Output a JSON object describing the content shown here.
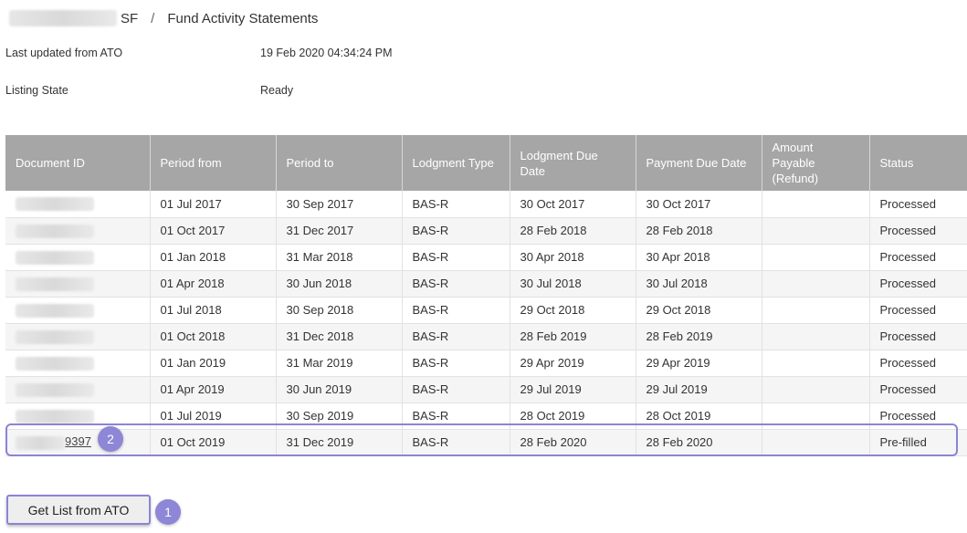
{
  "breadcrumb": {
    "fund_suffix": "SF",
    "separator": "/",
    "page": "Fund Activity Statements"
  },
  "info": {
    "last_updated_label": "Last updated from ATO",
    "last_updated_value": "19 Feb 2020 04:34:24 PM",
    "listing_state_label": "Listing State",
    "listing_state_value": "Ready"
  },
  "table": {
    "headers": {
      "document_id": "Document ID",
      "period_from": "Period from",
      "period_to": "Period to",
      "lodgment_type": "Lodgment Type",
      "lodgment_due_date": "Lodgment Due Date",
      "payment_due_date": "Payment Due Date",
      "amount_payable": "Amount Payable (Refund)",
      "status": "Status"
    },
    "rows": [
      {
        "period_from": "01 Jul 2017",
        "period_to": "30 Sep 2017",
        "lodgment_type": "BAS-R",
        "lodgment_due": "30 Oct 2017",
        "payment_due": "30 Oct 2017",
        "amount": "",
        "status": "Processed"
      },
      {
        "period_from": "01 Oct 2017",
        "period_to": "31 Dec 2017",
        "lodgment_type": "BAS-R",
        "lodgment_due": "28 Feb 2018",
        "payment_due": "28 Feb 2018",
        "amount": "",
        "status": "Processed"
      },
      {
        "period_from": "01 Jan 2018",
        "period_to": "31 Mar 2018",
        "lodgment_type": "BAS-R",
        "lodgment_due": "30 Apr 2018",
        "payment_due": "30 Apr 2018",
        "amount": "",
        "status": "Processed"
      },
      {
        "period_from": "01 Apr 2018",
        "period_to": "30 Jun 2018",
        "lodgment_type": "BAS-R",
        "lodgment_due": "30 Jul 2018",
        "payment_due": "30 Jul 2018",
        "amount": "",
        "status": "Processed"
      },
      {
        "period_from": "01 Jul 2018",
        "period_to": "30 Sep 2018",
        "lodgment_type": "BAS-R",
        "lodgment_due": "29 Oct 2018",
        "payment_due": "29 Oct 2018",
        "amount": "",
        "status": "Processed"
      },
      {
        "period_from": "01 Oct 2018",
        "period_to": "31 Dec 2018",
        "lodgment_type": "BAS-R",
        "lodgment_due": "28 Feb 2019",
        "payment_due": "28 Feb 2019",
        "amount": "",
        "status": "Processed"
      },
      {
        "period_from": "01 Jan 2019",
        "period_to": "31 Mar 2019",
        "lodgment_type": "BAS-R",
        "lodgment_due": "29 Apr 2019",
        "payment_due": "29 Apr 2019",
        "amount": "",
        "status": "Processed"
      },
      {
        "period_from": "01 Apr 2019",
        "period_to": "30 Jun 2019",
        "lodgment_type": "BAS-R",
        "lodgment_due": "29 Jul 2019",
        "payment_due": "29 Jul 2019",
        "amount": "",
        "status": "Processed"
      },
      {
        "period_from": "01 Jul 2019",
        "period_to": "30 Sep 2019",
        "lodgment_type": "BAS-R",
        "lodgment_due": "28 Oct 2019",
        "payment_due": "28 Oct 2019",
        "amount": "",
        "status": "Processed"
      },
      {
        "document_id_suffix": "9397",
        "period_from": "01 Oct 2019",
        "period_to": "31 Dec 2019",
        "lodgment_type": "BAS-R",
        "lodgment_due": "28 Feb 2020",
        "payment_due": "28 Feb 2020",
        "amount": "",
        "status": "Pre-filled"
      }
    ]
  },
  "annotations": {
    "badge_row": "2",
    "badge_button": "1",
    "accent_color": "#8b84d4"
  },
  "actions": {
    "get_list_label": "Get List from ATO"
  }
}
